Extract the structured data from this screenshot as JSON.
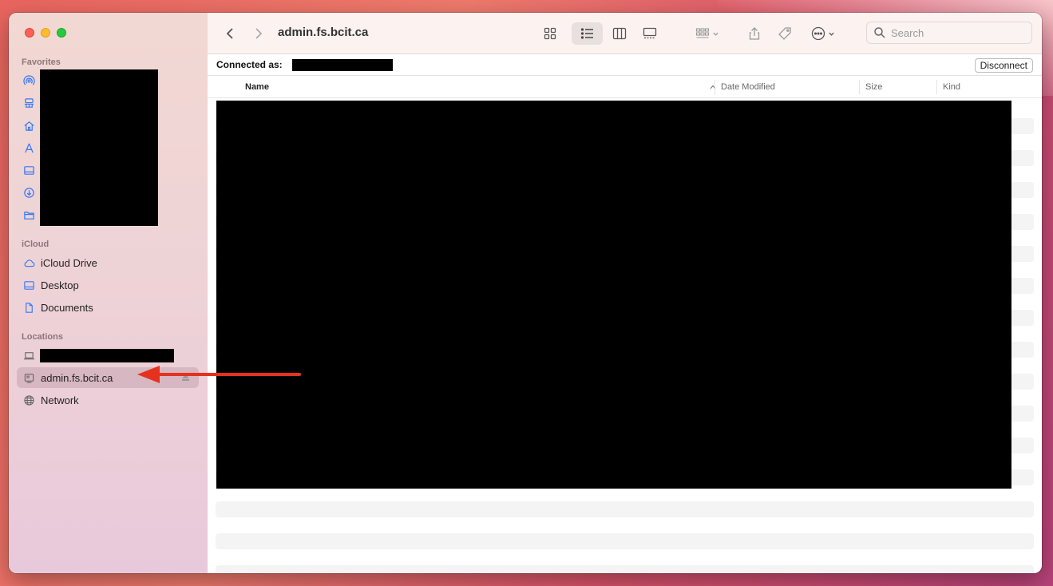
{
  "window": {
    "title": "admin.fs.bcit.ca"
  },
  "sidebar": {
    "favorites_heading": "Favorites",
    "favorites_icons": [
      "airdrop-icon",
      "recents-icon",
      "home-icon",
      "applications-icon",
      "desktop-icon",
      "downloads-icon",
      "folder-icon"
    ],
    "icloud_heading": "iCloud",
    "icloud_items": [
      {
        "label": "iCloud Drive",
        "icon": "cloud-icon"
      },
      {
        "label": "Desktop",
        "icon": "desktop-icon"
      },
      {
        "label": "Documents",
        "icon": "document-icon"
      }
    ],
    "locations_heading": "Locations",
    "locations_items": [
      {
        "label": "admin.fs.bcit.ca",
        "icon": "server-icon",
        "selected": true
      },
      {
        "label": "Network",
        "icon": "globe-icon"
      }
    ]
  },
  "toolbar": {
    "title": "admin.fs.bcit.ca",
    "search_placeholder": "Search",
    "active_view": "list"
  },
  "connection": {
    "label": "Connected as:",
    "disconnect_label": "Disconnect"
  },
  "columns": {
    "name": "Name",
    "date_modified": "Date Modified",
    "size": "Size",
    "kind": "Kind"
  },
  "colors": {
    "annotation_arrow": "#e5321e",
    "close": "#fe5f57",
    "minimize": "#febc2e",
    "zoom": "#28c840"
  }
}
